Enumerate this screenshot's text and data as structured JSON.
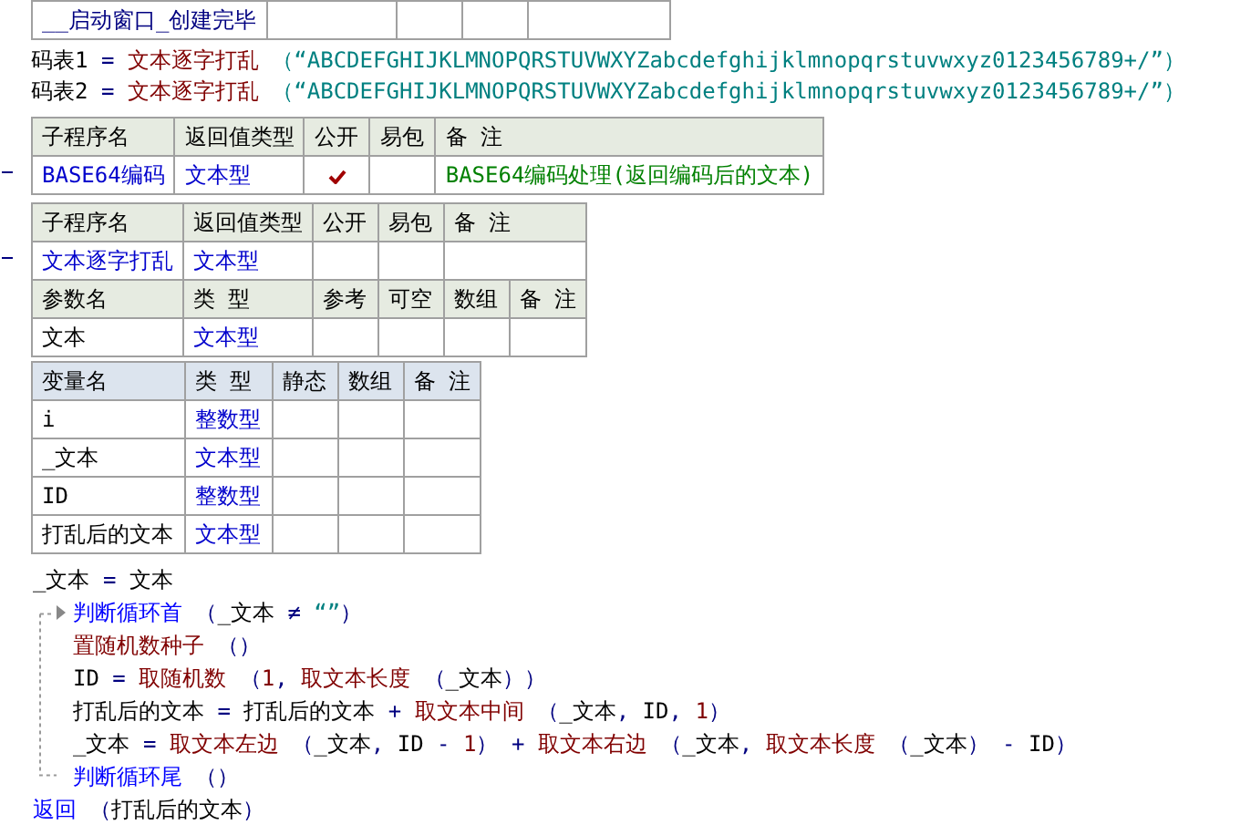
{
  "event_row": {
    "name": "__启动窗口_创建完毕"
  },
  "assignments": [
    {
      "tokens": [
        {
          "text": "码表1",
          "kind": "var"
        },
        {
          "text": " = ",
          "kind": "op"
        },
        {
          "text": "文本逐字打乱",
          "kind": "func"
        },
        {
          "text": " （“ABCDEFGHIJKLMNOPQRSTUVWXYZabcdefghijklmnopqrstuvwxyz0123456789+/”）",
          "kind": "str"
        }
      ]
    },
    {
      "tokens": [
        {
          "text": "码表2",
          "kind": "var"
        },
        {
          "text": " = ",
          "kind": "op"
        },
        {
          "text": "文本逐字打乱",
          "kind": "func"
        },
        {
          "text": " （“ABCDEFGHIJKLMNOPQRSTUVWXYZabcdefghijklmnopqrstuvwxyz0123456789+/”）",
          "kind": "str"
        }
      ]
    }
  ],
  "subroutines": [
    {
      "headers": [
        "子程序名",
        "返回值类型",
        "公开",
        "易包",
        "备 注"
      ],
      "name": "BASE64编码",
      "return_type": "文本型",
      "public": true,
      "packaged": false,
      "comment": "BASE64编码处理(返回编码后的文本)"
    },
    {
      "headers": [
        "子程序名",
        "返回值类型",
        "公开",
        "易包",
        "备 注"
      ],
      "name": "文本逐字打乱",
      "return_type": "文本型",
      "public": false,
      "packaged": false,
      "param_headers": [
        "参数名",
        "类 型",
        "参考",
        "可空",
        "数组",
        "备 注"
      ],
      "params": [
        {
          "name": "文本",
          "type": "文本型"
        }
      ]
    }
  ],
  "variables": {
    "headers": [
      "变量名",
      "类 型",
      "静态",
      "数组",
      "备 注"
    ],
    "rows": [
      {
        "name": "i",
        "type": "整数型"
      },
      {
        "name": "_文本",
        "type": "文本型"
      },
      {
        "name": "ID",
        "type": "整数型"
      },
      {
        "name": "打乱后的文本",
        "type": "文本型"
      }
    ]
  },
  "code": [
    {
      "kind": "line",
      "tokens": [
        {
          "text": "_文本",
          "kind": "var"
        },
        {
          "text": " = ",
          "kind": "op"
        },
        {
          "text": "文本",
          "kind": "var"
        }
      ]
    },
    {
      "kind": "loop",
      "head": [
        {
          "text": "判断循环首",
          "kind": "flow"
        },
        {
          "text": " （",
          "kind": "op"
        },
        {
          "text": "_文本",
          "kind": "var"
        },
        {
          "text": " ≠ ",
          "kind": "op"
        },
        {
          "text": "“”",
          "kind": "str"
        },
        {
          "text": "）",
          "kind": "op"
        }
      ],
      "children": [
        {
          "kind": "line",
          "tokens": [
            {
              "text": "置随机数种子",
              "kind": "func"
            },
            {
              "text": " （）",
              "kind": "op"
            }
          ]
        },
        {
          "kind": "line",
          "tokens": [
            {
              "text": "ID",
              "kind": "var"
            },
            {
              "text": " = ",
              "kind": "op"
            },
            {
              "text": "取随机数",
              "kind": "func"
            },
            {
              "text": " （",
              "kind": "op"
            },
            {
              "text": "1",
              "kind": "num"
            },
            {
              "text": ", ",
              "kind": "op"
            },
            {
              "text": "取文本长度",
              "kind": "func"
            },
            {
              "text": " （",
              "kind": "op"
            },
            {
              "text": "_文本",
              "kind": "var"
            },
            {
              "text": "））",
              "kind": "op"
            }
          ]
        },
        {
          "kind": "line",
          "tokens": [
            {
              "text": "打乱后的文本",
              "kind": "var"
            },
            {
              "text": " = ",
              "kind": "op"
            },
            {
              "text": "打乱后的文本",
              "kind": "var"
            },
            {
              "text": " + ",
              "kind": "op"
            },
            {
              "text": "取文本中间",
              "kind": "func"
            },
            {
              "text": " （",
              "kind": "op"
            },
            {
              "text": "_文本",
              "kind": "var"
            },
            {
              "text": ", ",
              "kind": "op"
            },
            {
              "text": "ID",
              "kind": "var"
            },
            {
              "text": ", ",
              "kind": "op"
            },
            {
              "text": "1",
              "kind": "num"
            },
            {
              "text": "）",
              "kind": "op"
            }
          ]
        },
        {
          "kind": "line",
          "tokens": [
            {
              "text": "_文本",
              "kind": "var"
            },
            {
              "text": " = ",
              "kind": "op"
            },
            {
              "text": "取文本左边",
              "kind": "func"
            },
            {
              "text": " （",
              "kind": "op"
            },
            {
              "text": "_文本",
              "kind": "var"
            },
            {
              "text": ", ",
              "kind": "op"
            },
            {
              "text": "ID",
              "kind": "var"
            },
            {
              "text": " - ",
              "kind": "op"
            },
            {
              "text": "1",
              "kind": "num"
            },
            {
              "text": "）",
              "kind": "op"
            },
            {
              "text": " + ",
              "kind": "op"
            },
            {
              "text": "取文本右边",
              "kind": "func"
            },
            {
              "text": " （",
              "kind": "op"
            },
            {
              "text": "_文本",
              "kind": "var"
            },
            {
              "text": ", ",
              "kind": "op"
            },
            {
              "text": "取文本长度",
              "kind": "func"
            },
            {
              "text": " （",
              "kind": "op"
            },
            {
              "text": "_文本",
              "kind": "var"
            },
            {
              "text": "）",
              "kind": "op"
            },
            {
              "text": " - ",
              "kind": "op"
            },
            {
              "text": "ID",
              "kind": "var"
            },
            {
              "text": "）",
              "kind": "op"
            }
          ]
        }
      ],
      "tail": [
        {
          "text": "判断循环尾",
          "kind": "flow"
        },
        {
          "text": " （）",
          "kind": "op"
        }
      ]
    },
    {
      "kind": "line",
      "tokens": [
        {
          "text": "返回",
          "kind": "flow"
        },
        {
          "text": " （",
          "kind": "op"
        },
        {
          "text": "打乱后的文本",
          "kind": "var"
        },
        {
          "text": "）",
          "kind": "op"
        }
      ]
    }
  ]
}
